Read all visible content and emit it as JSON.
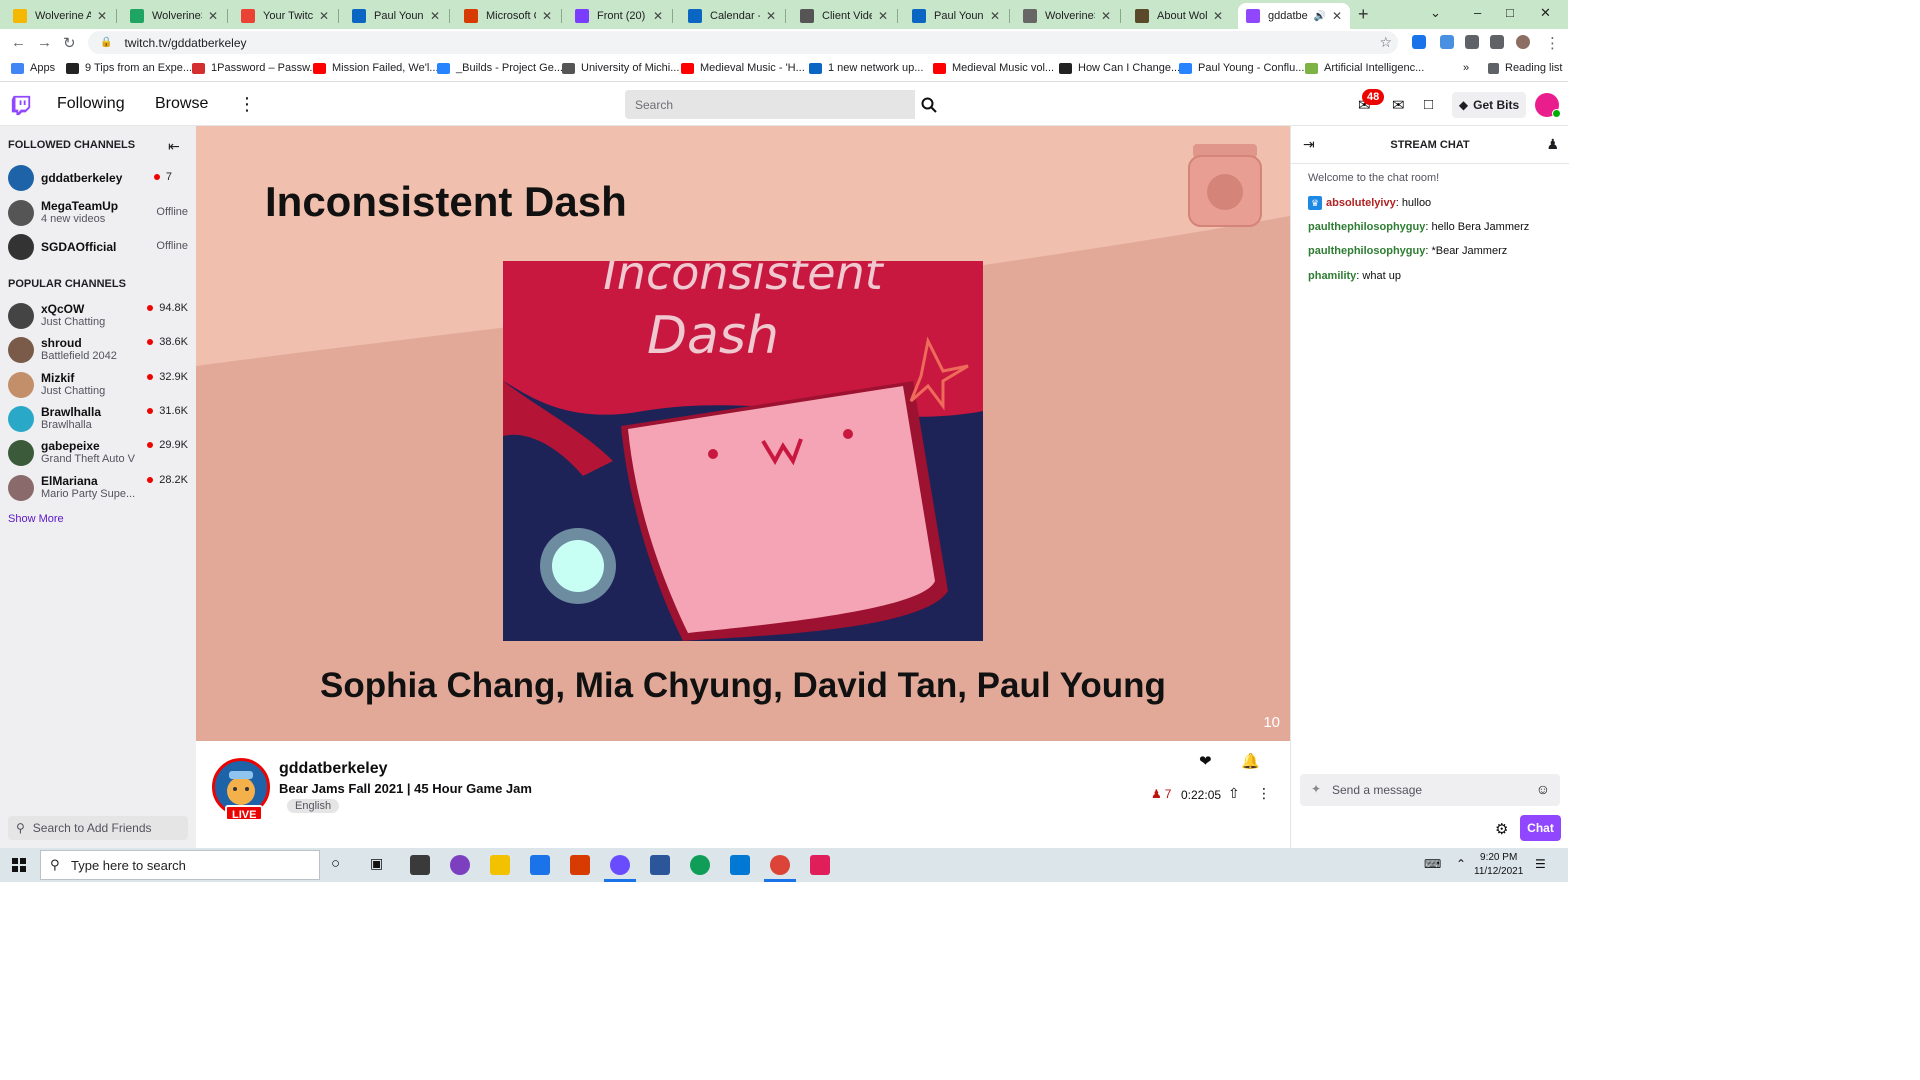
{
  "browser": {
    "tabs": [
      {
        "label": "Wolverine Ac",
        "color": "#f5b800"
      },
      {
        "label": "WolverineSof",
        "color": "#1fa463"
      },
      {
        "label": "Your Twitch L",
        "color": "#ea4335"
      },
      {
        "label": "Paul Young | L",
        "color": "#0a66c2"
      },
      {
        "label": "Microsoft Off",
        "color": "#d83b01"
      },
      {
        "label": "Front (20)",
        "color": "#7a3cff"
      },
      {
        "label": "Calendar - Pa",
        "color": "#0a66c2"
      },
      {
        "label": "Client Videos",
        "color": "#555555"
      },
      {
        "label": "Paul Young | L",
        "color": "#0a66c2"
      },
      {
        "label": "WolverineSof",
        "color": "#666666"
      },
      {
        "label": "About Wolve",
        "color": "#5a4a2a"
      },
      {
        "label": "gddatbe",
        "color": "#9147ff"
      }
    ],
    "url": "twitch.tv/gddatberkeley",
    "bookmarks": [
      {
        "label": "Apps",
        "color": "#4285f4"
      },
      {
        "label": "9 Tips from an Expe...",
        "color": "#222222"
      },
      {
        "label": "1Password – Passw...",
        "color": "#d32f2f"
      },
      {
        "label": "Mission Failed, We'l...",
        "color": "#ff0000"
      },
      {
        "label": "_Builds - Project Ge...",
        "color": "#2684ff"
      },
      {
        "label": "University of Michi...",
        "color": "#555555"
      },
      {
        "label": "Medieval Music - 'H...",
        "color": "#ff0000"
      },
      {
        "label": "1 new network up...",
        "color": "#0a66c2"
      },
      {
        "label": "Medieval Music vol...",
        "color": "#ff0000"
      },
      {
        "label": "How Can I Change...",
        "color": "#222222"
      },
      {
        "label": "Paul Young - Conflu...",
        "color": "#2684ff"
      },
      {
        "label": "Artificial Intelligenc...",
        "color": "#7cb342"
      }
    ],
    "reading_list": "Reading list"
  },
  "twitch": {
    "nav": {
      "following": "Following",
      "browse": "Browse"
    },
    "search_placeholder": "Search",
    "notifications": "48",
    "get_bits": "Get Bits",
    "brand_color": "#9147ff"
  },
  "sidebar": {
    "followed_heading": "FOLLOWED CHANNELS",
    "followed": [
      {
        "name": "gddatberkeley",
        "sub": "",
        "status": "7",
        "live": true,
        "color": "#1e63a8"
      },
      {
        "name": "MegaTeamUp",
        "sub": "4 new videos",
        "status": "Offline",
        "live": false,
        "color": "#555555"
      },
      {
        "name": "SGDAOfficial",
        "sub": "",
        "status": "Offline",
        "live": false,
        "color": "#333333"
      }
    ],
    "popular_heading": "POPULAR CHANNELS",
    "popular": [
      {
        "name": "xQcOW",
        "sub": "Just Chatting",
        "status": "94.8K",
        "color": "#444444"
      },
      {
        "name": "shroud",
        "sub": "Battlefield 2042",
        "status": "38.6K",
        "color": "#7a5a48"
      },
      {
        "name": "Mizkif",
        "sub": "Just Chatting",
        "status": "32.9K",
        "color": "#c28f6a"
      },
      {
        "name": "Brawlhalla",
        "sub": "Brawlhalla",
        "status": "31.6K",
        "color": "#2aa8c8"
      },
      {
        "name": "gabepeixe",
        "sub": "Grand Theft Auto V",
        "status": "29.9K",
        "color": "#3a5a3a"
      },
      {
        "name": "ElMariana",
        "sub": "Mario Party Supe...",
        "status": "28.2K",
        "color": "#8a6a6a"
      }
    ],
    "show_more": "Show More",
    "friends_placeholder": "Search to Add Friends"
  },
  "stream": {
    "slide_title": "Inconsistent Dash",
    "art_text_line1": "Inconsistent",
    "art_text_line2": "Dash",
    "authors": "Sophia Chang, Mia Chyung, David Tan, Paul Young",
    "slide_number": "10",
    "channel": "gddatberkeley",
    "title": "Bear Jams Fall 2021 | 45 Hour Game Jam",
    "tag": "English",
    "live_label": "LIVE",
    "viewers": "7",
    "uptime": "0:22:05"
  },
  "chat": {
    "heading": "STREAM CHAT",
    "welcome": "Welcome to the chat room!",
    "messages": [
      {
        "user": "absolutelyivy",
        "text": ": hulloo",
        "color": "#b22222"
      },
      {
        "user": "paulthephilosophyguy",
        "text": ": hello Bera Jammerz",
        "color": "#2e7d32"
      },
      {
        "user": "paulthephilosophyguy",
        "text": ": *Bear Jammerz",
        "color": "#2e7d32"
      },
      {
        "user": "phamility",
        "text": ": what up",
        "color": "#2e7d32"
      }
    ],
    "input_placeholder": "Send a message",
    "chat_button": "Chat"
  },
  "taskbar": {
    "search_placeholder": "Type here to search",
    "time": "9:20 PM",
    "date": "11/12/2021"
  }
}
